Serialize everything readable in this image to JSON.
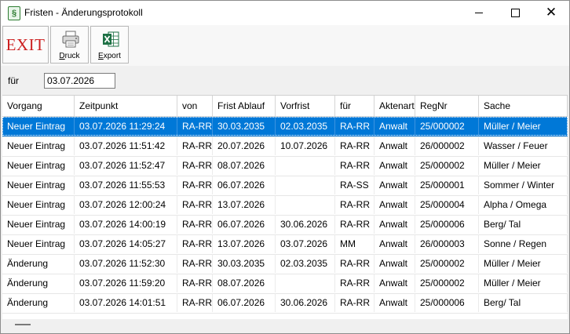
{
  "window": {
    "title": "Fristen - Änderungsprotokoll",
    "app_icon": "§",
    "minimize_icon": "minimize-icon",
    "maximize_icon": "maximize-icon",
    "close_label": "✕"
  },
  "toolbar": {
    "exit_label": "EXIT",
    "print_label_first": "D",
    "print_label_rest": "ruck",
    "export_label_first": "E",
    "export_label_rest": "xport",
    "print_icon": "printer-icon",
    "export_icon": "excel-icon",
    "excel_color": "#1e7145"
  },
  "filter": {
    "label": "für",
    "value": "03.07.2026"
  },
  "table": {
    "columns": [
      "Vorgang",
      "Zeitpunkt",
      "von",
      "Frist Ablauf",
      "Vorfrist",
      "für",
      "Aktenart",
      "RegNr",
      "Sache"
    ],
    "rows": [
      [
        "Neuer Eintrag",
        "03.07.2026 11:29:24",
        "RA-RR",
        "30.03.2035",
        "02.03.2035",
        "RA-RR",
        "Anwalt",
        "25/000002",
        "Müller / Meier"
      ],
      [
        "Neuer Eintrag",
        "03.07.2026 11:51:42",
        "RA-RR",
        "20.07.2026",
        "10.07.2026",
        "RA-RR",
        "Anwalt",
        "26/000002",
        "Wasser / Feuer"
      ],
      [
        "Neuer Eintrag",
        "03.07.2026 11:52:47",
        "RA-RR",
        "08.07.2026",
        "",
        "RA-RR",
        "Anwalt",
        "25/000002",
        "Müller / Meier"
      ],
      [
        "Neuer Eintrag",
        "03.07.2026 11:55:53",
        "RA-RR",
        "06.07.2026",
        "",
        "RA-SS",
        "Anwalt",
        "25/000001",
        "Sommer / Winter"
      ],
      [
        "Neuer Eintrag",
        "03.07.2026 12:00:24",
        "RA-RR",
        "13.07.2026",
        "",
        "RA-RR",
        "Anwalt",
        "25/000004",
        "Alpha / Omega"
      ],
      [
        "Neuer Eintrag",
        "03.07.2026 14:00:19",
        "RA-RR",
        "06.07.2026",
        "30.06.2026",
        "RA-RR",
        "Anwalt",
        "25/000006",
        "Berg/ Tal"
      ],
      [
        "Neuer Eintrag",
        "03.07.2026 14:05:27",
        "RA-RR",
        "13.07.2026",
        "03.07.2026",
        "MM",
        "Anwalt",
        "26/000003",
        "Sonne / Regen"
      ],
      [
        "Änderung",
        "03.07.2026 11:52:30",
        "RA-RR",
        "30.03.2035",
        "02.03.2035",
        "RA-RR",
        "Anwalt",
        "25/000002",
        "Müller / Meier"
      ],
      [
        "Änderung",
        "03.07.2026 11:59:20",
        "RA-RR",
        "08.07.2026",
        "",
        "RA-RR",
        "Anwalt",
        "25/000002",
        "Müller / Meier"
      ],
      [
        "Änderung",
        "03.07.2026 14:01:51",
        "RA-RR",
        "06.07.2026",
        "30.06.2026",
        "RA-RR",
        "Anwalt",
        "25/000006",
        "Berg/ Tal"
      ]
    ],
    "selected_row": 0,
    "selection_color": "#0078d7"
  }
}
